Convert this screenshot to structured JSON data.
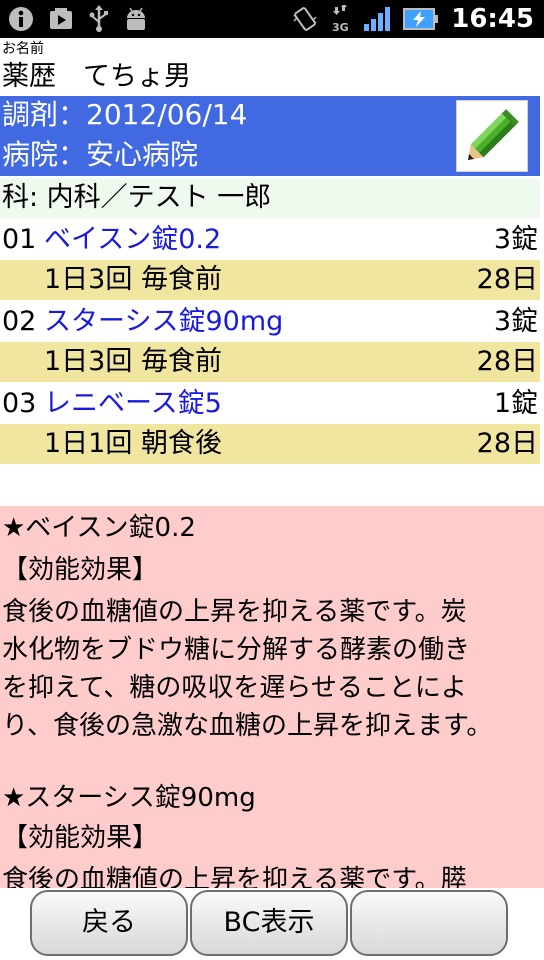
{
  "status_bar": {
    "time": "16:45",
    "network": "3G",
    "icons": [
      "info-icon",
      "youtube-icon",
      "usb-icon",
      "android-debug-icon",
      "vibrate-icon",
      "3g-icon",
      "signal-icon",
      "battery-charging-icon"
    ]
  },
  "patient": {
    "label": "お名前",
    "name": "薬歴　てちょ男"
  },
  "prescription": {
    "date_line": "調剤：2012/06/14",
    "hospital_line": "病院：安心病院",
    "edit_icon": "pencil-icon"
  },
  "department_line": "科: 内科／テスト 一郎",
  "drugs": [
    {
      "no": "01",
      "name": "ベイスン錠0.2",
      "qty": "3錠",
      "dose": "1日3回 毎食前",
      "days": "28日"
    },
    {
      "no": "02",
      "name": "スターシス錠90mg",
      "qty": "3錠",
      "dose": "1日3回 毎食前",
      "days": "28日"
    },
    {
      "no": "03",
      "name": "レニベース錠5",
      "qty": "1錠",
      "dose": "1日1回 朝食後",
      "days": "28日"
    }
  ],
  "info_lines": [
    "★ベイスン錠0.2",
    "【効能効果】",
    "食後の血糖値の上昇を抑える薬です。炭",
    "水化物をブドウ糖に分解する酵素の働き",
    "を抑えて、糖の吸収を遅らせることによ",
    "り、食後の急激な血糖の上昇を抑えます。",
    "",
    "★スターシス錠90mg",
    "【効能効果】",
    "食後の血糖値の上昇を抑える薬です。膵"
  ],
  "buttons": {
    "back": "戻る",
    "bc": "BC表示",
    "third": ""
  },
  "colors": {
    "header_blue": "#4169e1",
    "drug_name": "#1a1adc",
    "dose_row": "#f0e6a0",
    "info_bg": "#ffcccc",
    "dept_bg": "#eefaee"
  }
}
